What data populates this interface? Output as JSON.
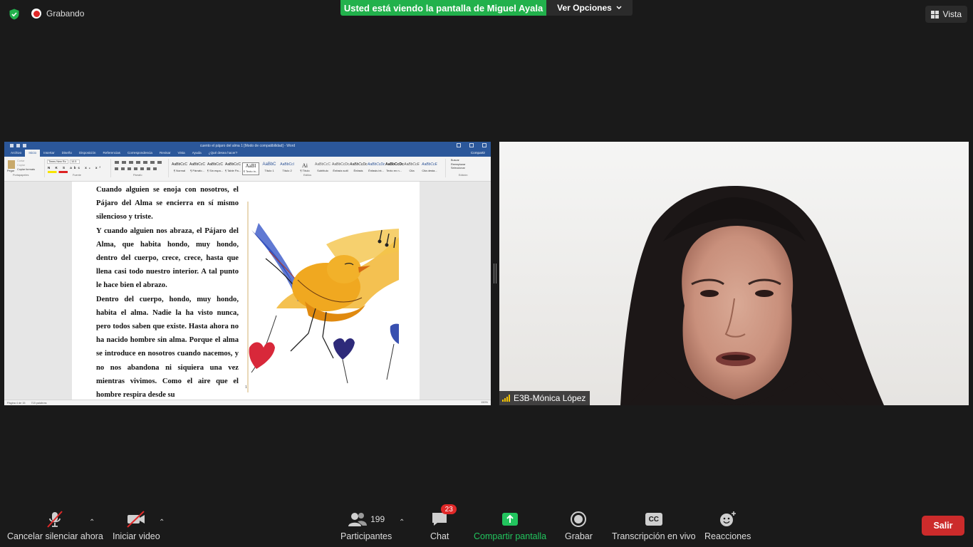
{
  "meeting": {
    "recording_label": "Grabando",
    "share_banner": "Usted está viendo la pantalla de Miguel Ayala",
    "view_options_label": "Ver Opciones",
    "view_label": "Vista"
  },
  "word": {
    "title": "cuento el pájaro del alma 1 [Modo de compatibilidad] - Word",
    "tabs": [
      "Archivo",
      "Inicio",
      "Insertar",
      "Diseño",
      "Disposición",
      "Referencias",
      "Correspondencia",
      "Revisar",
      "Vista",
      "Ayuda",
      "¿Qué desea hacer?"
    ],
    "active_tab": "Inicio",
    "share_label": "Compartir",
    "ribbon": {
      "clipboard": [
        "Pegar",
        "Cortar",
        "Copiar",
        "Copiar formato"
      ],
      "font_name": "Times New Ro",
      "font_size": "10.5",
      "groups": [
        "Portapapeles",
        "Fuente",
        "Párrafo",
        "Estilos",
        "Edición"
      ],
      "styles": [
        {
          "sample": "AaBbCcC",
          "name": "¶ Normal"
        },
        {
          "sample": "AaBbCcC",
          "name": "¶ Párrafo..."
        },
        {
          "sample": "AaBbCcC",
          "name": "¶ Sin espa..."
        },
        {
          "sample": "AaBbCcC",
          "name": "¶ Table Pa..."
        },
        {
          "sample": "AaBl",
          "name": "¶ Texto in..."
        },
        {
          "sample": "AaBbC",
          "name": "Título 1"
        },
        {
          "sample": "AaBbCcl",
          "name": "Título 2"
        },
        {
          "sample": "Ai",
          "name": "¶ Título"
        },
        {
          "sample": "AaBbCcC",
          "name": "Subtítulo"
        },
        {
          "sample": "AaBbCcDc",
          "name": "Énfasis sutil"
        },
        {
          "sample": "AaBbCcDc",
          "name": "Énfasis"
        },
        {
          "sample": "AaBbCcDc",
          "name": "Énfasis int..."
        },
        {
          "sample": "AaBbCcDc",
          "name": "Texto en n..."
        },
        {
          "sample": "AaBbCcE",
          "name": "Cita"
        },
        {
          "sample": "AaBbCcE",
          "name": "Cita desta..."
        }
      ],
      "editing": [
        "Buscar",
        "Reemplazar",
        "Seleccionar"
      ]
    },
    "paragraphs": [
      "Cuando alguien se enoja con nosotros, el Pájaro del Alma se encierra en sí mismo silencioso y triste.",
      "Y cuando alguien nos abraza, el Pájaro del Alma, que habita hondo, muy hondo, dentro del cuerpo, crece, crece, hasta que llena casi todo nuestro interior. A tal punto le hace bien el abrazo.",
      "Dentro del cuerpo, hondo, muy hondo, habita el alma. Nadie la ha visto nunca, pero todos saben que existe. Hasta ahora no ha nacido hombre sin alma. Porque el alma se introduce en nosotros cuando nacemos, y no nos abandona ni siquiera una vez mientras vivimos. Como el aire que el hombre respira desde su"
    ],
    "page_number": "1",
    "status": {
      "page": "Página 4 de 15",
      "words": "715 palabras",
      "zoom": "150%"
    }
  },
  "participant": {
    "name": "E3B-Mónica López"
  },
  "toolbar": {
    "mute_label": "Cancelar silenciar ahora",
    "video_label": "Iniciar video",
    "participants_label": "Participantes",
    "participants_count": "199",
    "chat_label": "Chat",
    "chat_badge": "23",
    "share_label": "Compartir pantalla",
    "record_label": "Grabar",
    "transcription_label": "Transcripción en vivo",
    "cc_label": "CC",
    "reactions_label": "Reacciones",
    "leave_label": "Salir"
  },
  "colors": {
    "share_green": "#22b14c",
    "word_blue": "#2b579a",
    "leave_red": "#cc2b2b",
    "badge_red": "#e02828",
    "signal_yellow": "#f5c400"
  }
}
